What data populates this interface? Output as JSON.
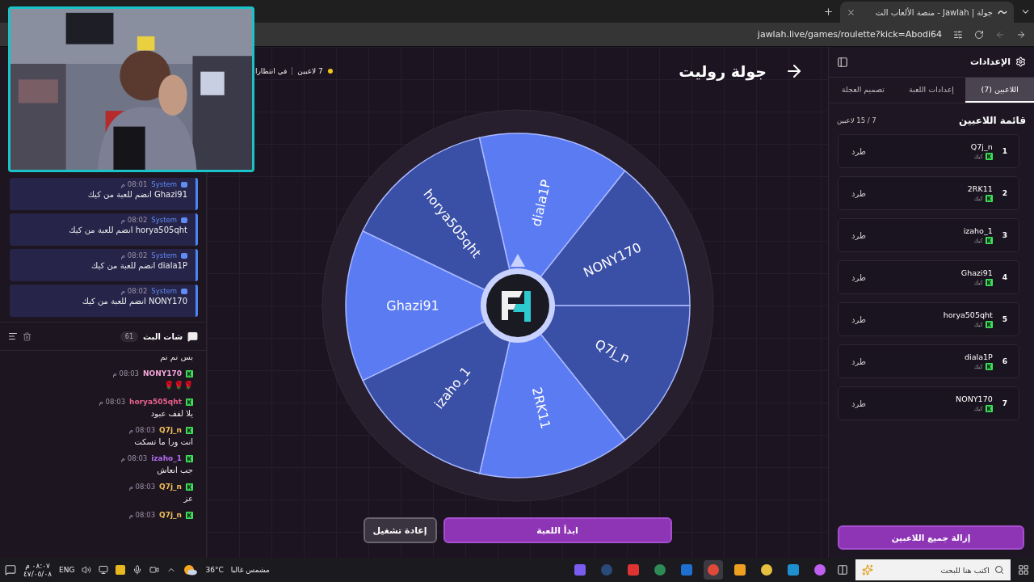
{
  "browser": {
    "tab_title": "جولة | Jawlah - منصة الألعاب الت",
    "url": "jawlah.live/games/roulette?kick=Abodi64"
  },
  "chat": {
    "system_messages": [
      {
        "user": "System",
        "time": "08:01 م",
        "text": "Ghazi91 انضم للعبة من كيك"
      },
      {
        "user": "System",
        "time": "08:02 م",
        "text": "horya505qht انضم للعبة من كيك"
      },
      {
        "user": "System",
        "time": "08:02 م",
        "text": "diala1P انضم للعبة من كيك"
      },
      {
        "user": "System",
        "time": "08:02 م",
        "text": "NONY170 انضم للعبة من كيك"
      }
    ],
    "title": "شات البث",
    "count": "61",
    "messages": [
      {
        "text": "بس نم نم"
      },
      {
        "user": "NONY170",
        "time": "08:03 م",
        "text": "🌹🌹🌹",
        "color": "#f2a6d8"
      },
      {
        "user": "horya505qht",
        "time": "08:03 م",
        "text": "يلا لفف عبود",
        "color": "#e8628e"
      },
      {
        "user": "Q7j_n",
        "time": "08:03 م",
        "text": "انت ورا ما تسكت",
        "color": "#f2c25a"
      },
      {
        "user": "izaho_1",
        "time": "08:03 م",
        "text": "جب انعاش",
        "color": "#b46cf2"
      },
      {
        "user": "Q7j_n",
        "time": "08:03 م",
        "text": "عز",
        "color": "#f2c25a"
      },
      {
        "user": "Q7j_n",
        "time": "08:03 م",
        "color": "#f2c25a"
      }
    ]
  },
  "game": {
    "title": "جولة روليت",
    "players_count": "7 لاعبين",
    "status": "في انتظارا",
    "wheel": {
      "segments": [
        {
          "label": "diala1P",
          "color": "#5b7bf2"
        },
        {
          "label": "NONY170",
          "color": "#3a4fa6"
        },
        {
          "label": "Q7j_n",
          "color": "#3a4fa6"
        },
        {
          "label": "2RK11",
          "color": "#5b7bf2"
        },
        {
          "label": "izaho_1",
          "color": "#3a4fa6"
        },
        {
          "label": "Ghazi91",
          "color": "#5b7bf2"
        },
        {
          "label": "horya505qht",
          "color": "#3a4fa6"
        }
      ]
    },
    "buttons": [
      {
        "label": "ابدأ اللعبة",
        "kind": "primary"
      },
      {
        "label": "إعادة تشغيل",
        "kind": "secondary"
      }
    ]
  },
  "settings": {
    "title": "الإعدادات",
    "tabs": [
      {
        "label": "اللاعبين (7)",
        "selected": true
      },
      {
        "label": "إعدادات اللعبة",
        "selected": false
      },
      {
        "label": "تصميم العجلة",
        "selected": false
      }
    ],
    "list_title": "قائمة اللاعبين",
    "capacity": "7 / 15 لاعبين",
    "players": [
      {
        "index": "1",
        "name": "Q7j_n",
        "platform": "كيك",
        "action": "طرد"
      },
      {
        "index": "2",
        "name": "2RK11",
        "platform": "كيك",
        "action": "طرد"
      },
      {
        "index": "3",
        "name": "izaho_1",
        "platform": "كيك",
        "action": "طرد"
      },
      {
        "index": "4",
        "name": "Ghazi91",
        "platform": "كيك",
        "action": "طرد"
      },
      {
        "index": "5",
        "name": "horya505qht",
        "platform": "كيك",
        "action": "طرد"
      },
      {
        "index": "6",
        "name": "diala1P",
        "platform": "كيك",
        "action": "طرد"
      },
      {
        "index": "7",
        "name": "NONY170",
        "platform": "كيك",
        "action": "طرد"
      }
    ],
    "clear_button": "إزالة جميع اللاعبين"
  },
  "taskbar": {
    "search_placeholder": "اكتب هنا للبحث",
    "weather_temp": "36°C",
    "weather_condition": "مشمس غالبا",
    "language": "ENG",
    "time": "٠٨:٠٧ م",
    "date": "٤٧/٠٥/٠٨"
  }
}
